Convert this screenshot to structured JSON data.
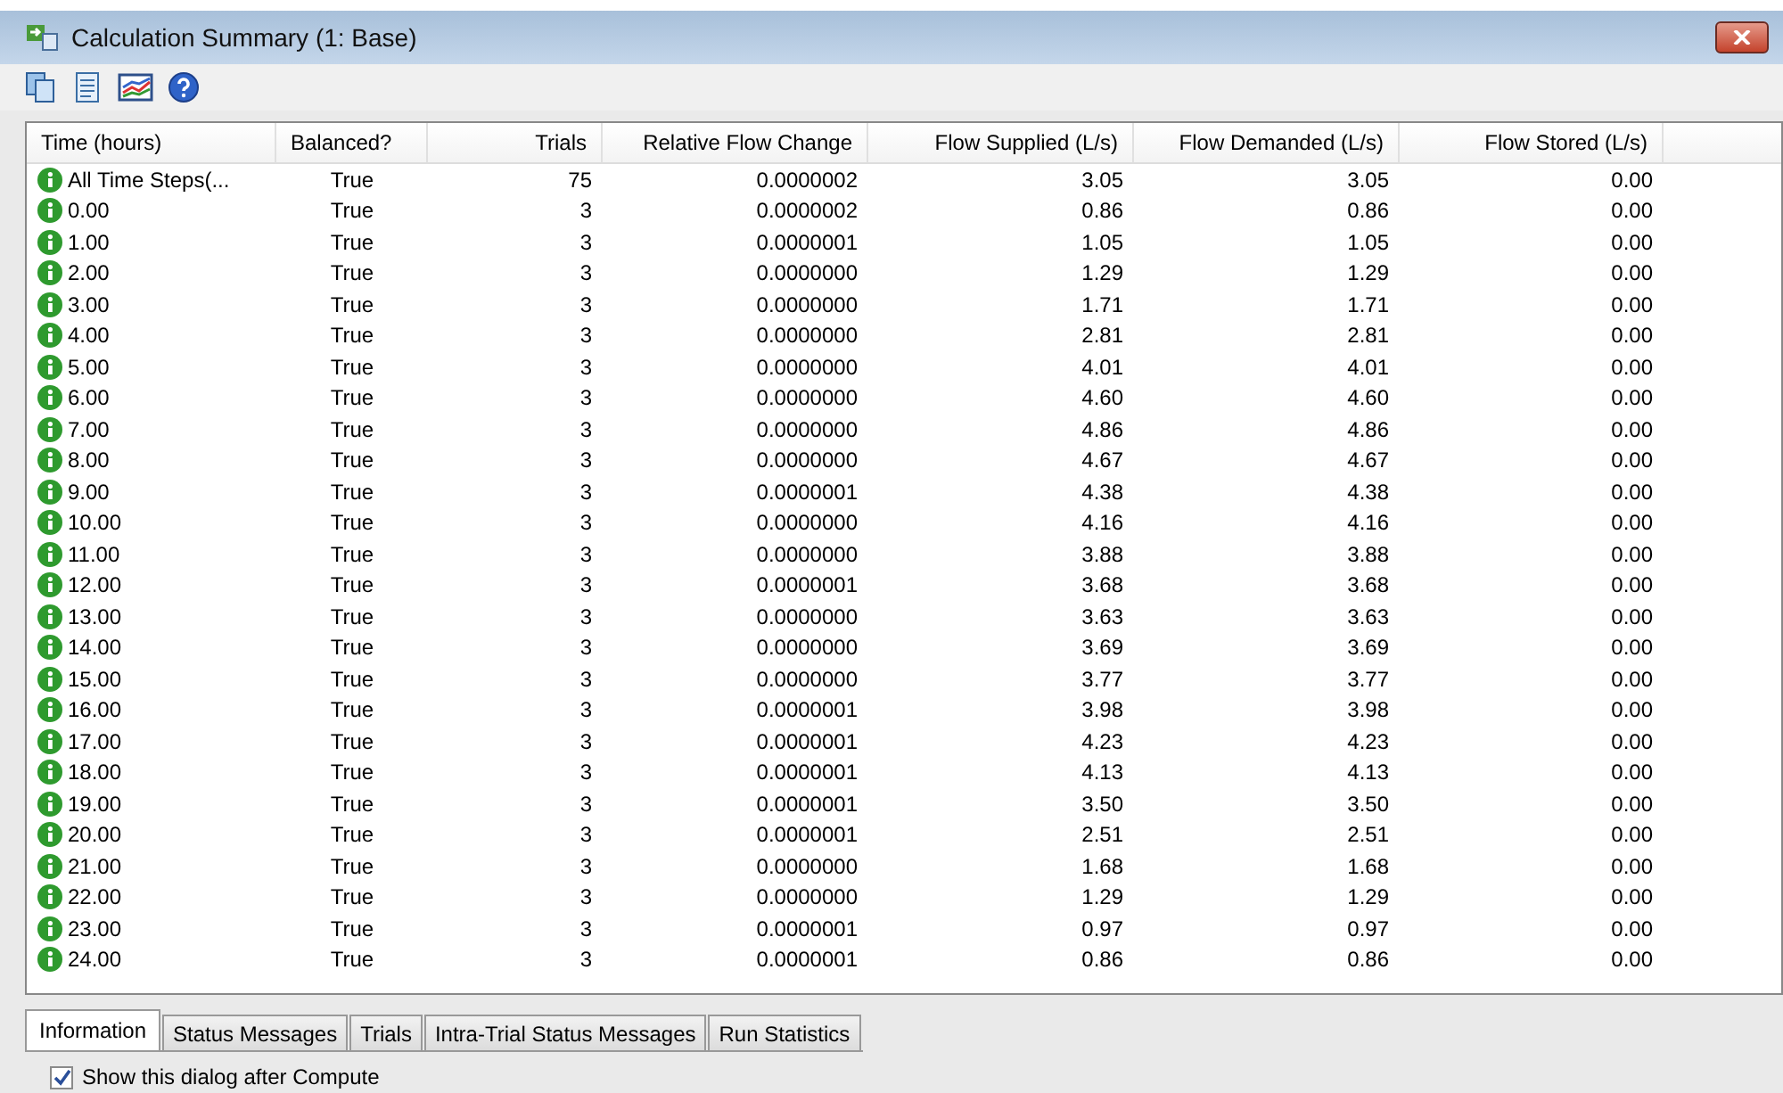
{
  "window": {
    "title": "Calculation Summary (1: Base)"
  },
  "table": {
    "columns": [
      "Time (hours)",
      "Balanced?",
      "Trials",
      "Relative Flow Change",
      "Flow Supplied (L/s)",
      "Flow Demanded (L/s)",
      "Flow Stored (L/s)"
    ],
    "rows": [
      [
        "All Time Steps(...",
        "True",
        "75",
        "0.0000002",
        "3.05",
        "3.05",
        "0.00"
      ],
      [
        "0.00",
        "True",
        "3",
        "0.0000002",
        "0.86",
        "0.86",
        "0.00"
      ],
      [
        "1.00",
        "True",
        "3",
        "0.0000001",
        "1.05",
        "1.05",
        "0.00"
      ],
      [
        "2.00",
        "True",
        "3",
        "0.0000000",
        "1.29",
        "1.29",
        "0.00"
      ],
      [
        "3.00",
        "True",
        "3",
        "0.0000000",
        "1.71",
        "1.71",
        "0.00"
      ],
      [
        "4.00",
        "True",
        "3",
        "0.0000000",
        "2.81",
        "2.81",
        "0.00"
      ],
      [
        "5.00",
        "True",
        "3",
        "0.0000000",
        "4.01",
        "4.01",
        "0.00"
      ],
      [
        "6.00",
        "True",
        "3",
        "0.0000000",
        "4.60",
        "4.60",
        "0.00"
      ],
      [
        "7.00",
        "True",
        "3",
        "0.0000000",
        "4.86",
        "4.86",
        "0.00"
      ],
      [
        "8.00",
        "True",
        "3",
        "0.0000000",
        "4.67",
        "4.67",
        "0.00"
      ],
      [
        "9.00",
        "True",
        "3",
        "0.0000001",
        "4.38",
        "4.38",
        "0.00"
      ],
      [
        "10.00",
        "True",
        "3",
        "0.0000000",
        "4.16",
        "4.16",
        "0.00"
      ],
      [
        "11.00",
        "True",
        "3",
        "0.0000000",
        "3.88",
        "3.88",
        "0.00"
      ],
      [
        "12.00",
        "True",
        "3",
        "0.0000001",
        "3.68",
        "3.68",
        "0.00"
      ],
      [
        "13.00",
        "True",
        "3",
        "0.0000000",
        "3.63",
        "3.63",
        "0.00"
      ],
      [
        "14.00",
        "True",
        "3",
        "0.0000000",
        "3.69",
        "3.69",
        "0.00"
      ],
      [
        "15.00",
        "True",
        "3",
        "0.0000000",
        "3.77",
        "3.77",
        "0.00"
      ],
      [
        "16.00",
        "True",
        "3",
        "0.0000001",
        "3.98",
        "3.98",
        "0.00"
      ],
      [
        "17.00",
        "True",
        "3",
        "0.0000001",
        "4.23",
        "4.23",
        "0.00"
      ],
      [
        "18.00",
        "True",
        "3",
        "0.0000001",
        "4.13",
        "4.13",
        "0.00"
      ],
      [
        "19.00",
        "True",
        "3",
        "0.0000001",
        "3.50",
        "3.50",
        "0.00"
      ],
      [
        "20.00",
        "True",
        "3",
        "0.0000001",
        "2.51",
        "2.51",
        "0.00"
      ],
      [
        "21.00",
        "True",
        "3",
        "0.0000000",
        "1.68",
        "1.68",
        "0.00"
      ],
      [
        "22.00",
        "True",
        "3",
        "0.0000000",
        "1.29",
        "1.29",
        "0.00"
      ],
      [
        "23.00",
        "True",
        "3",
        "0.0000001",
        "0.97",
        "0.97",
        "0.00"
      ],
      [
        "24.00",
        "True",
        "3",
        "0.0000001",
        "0.86",
        "0.86",
        "0.00"
      ]
    ]
  },
  "tabs": [
    {
      "label": "Information",
      "selected": true
    },
    {
      "label": "Status Messages",
      "selected": false
    },
    {
      "label": "Trials",
      "selected": false
    },
    {
      "label": "Intra-Trial Status Messages",
      "selected": false
    },
    {
      "label": "Run Statistics",
      "selected": false
    }
  ],
  "show_dialog": {
    "label": "Show this dialog after Compute",
    "checked": true
  }
}
